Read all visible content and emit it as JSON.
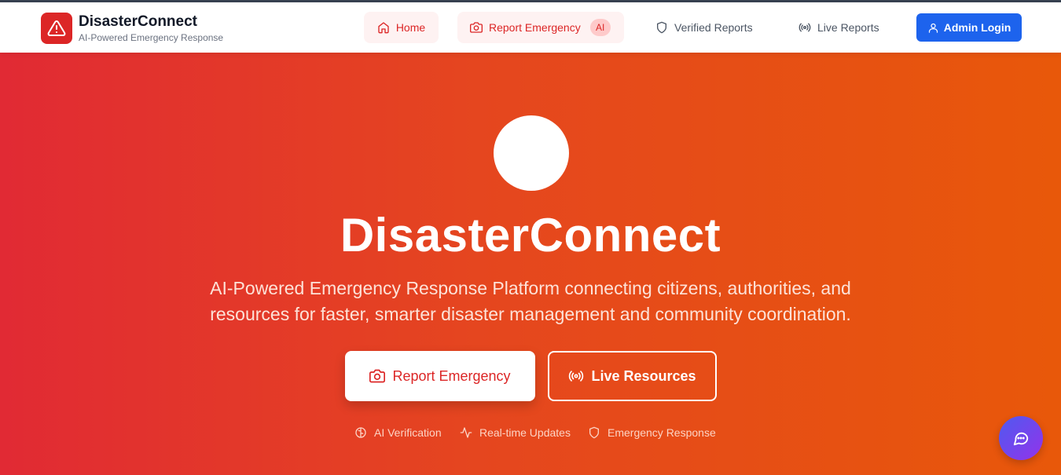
{
  "brand": {
    "name": "DisasterConnect",
    "tagline": "AI-Powered Emergency Response",
    "logo_icon": "alert-triangle-icon"
  },
  "nav": {
    "home": "Home",
    "report": "Report Emergency",
    "report_badge": "AI",
    "verified": "Verified Reports",
    "live": "Live Reports",
    "admin": "Admin Login"
  },
  "hero": {
    "title": "DisasterConnect",
    "subtitle": "AI-Powered Emergency Response Platform connecting citizens, authorities, and resources for faster, smarter disaster management and community coordination.",
    "primary_button": "Report Emergency",
    "secondary_button": "Live Resources",
    "features": [
      "AI Verification",
      "Real-time Updates",
      "Emergency Response"
    ]
  },
  "colors": {
    "accent": "#dc2626",
    "primary_blue": "#1d63ed",
    "hero_start": "#e12a34",
    "hero_end": "#e8580a",
    "chat_fab": "#7c3aed"
  }
}
